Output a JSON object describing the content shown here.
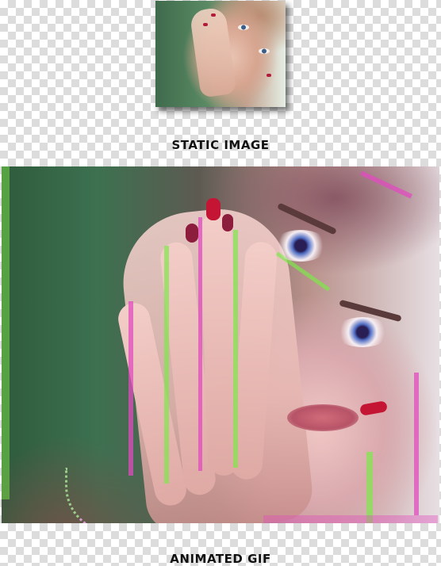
{
  "labels": {
    "static": "STATIC IMAGE",
    "animated": "ANIMATED GIF"
  },
  "images": {
    "static_image": "portrait-photo",
    "animated_image": "glitch-portrait-photo"
  }
}
